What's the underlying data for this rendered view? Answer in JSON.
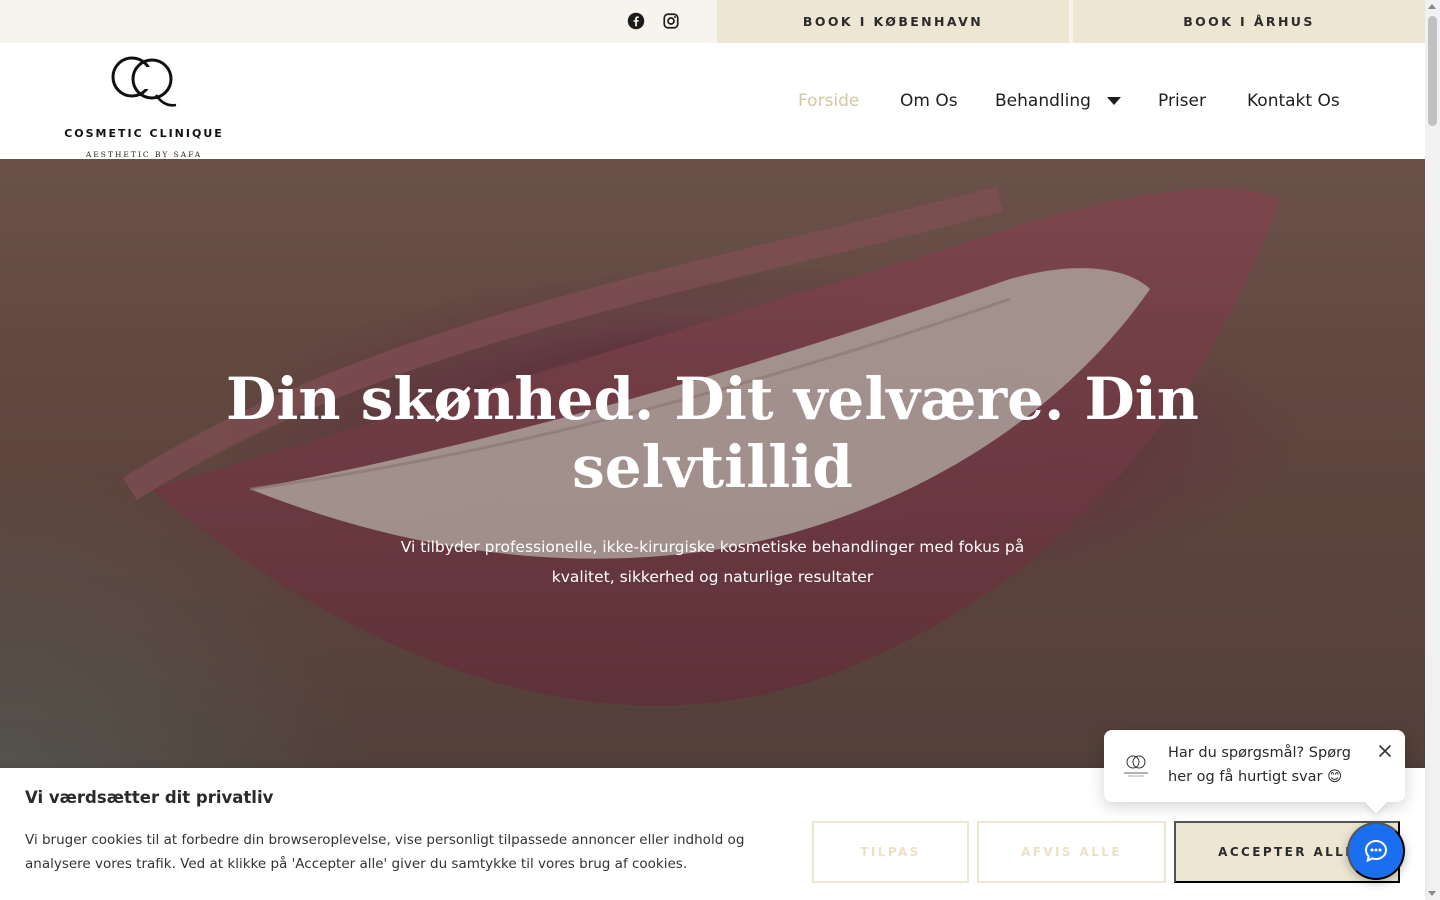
{
  "topbar": {
    "social": [
      {
        "icon": "facebook-icon"
      },
      {
        "icon": "instagram-icon"
      }
    ],
    "book_copenhagen": "BOOK I KØBENHAVN",
    "book_aarhus": "BOOK I ÅRHUS"
  },
  "logo": {
    "mark": "CQ",
    "name": "COSMETIC CLINIQUE",
    "tagline": "AESTHETIC BY SAFA"
  },
  "nav": {
    "items": [
      {
        "label": "Forside",
        "active": true
      },
      {
        "label": "Om Os"
      },
      {
        "label": "Behandling",
        "has_dropdown": true
      },
      {
        "label": "Priser"
      },
      {
        "label": "Kontakt Os"
      }
    ]
  },
  "hero": {
    "title": "Din skønhed. Dit velvære. Din selvtillid",
    "subtitle": "Vi tilbyder professionelle, ikke-kirurgiske kosmetiske behandlinger med fokus på kvalitet, sikkerhed og naturlige resultater"
  },
  "cookie": {
    "title": "Vi værdsætter dit privatliv",
    "text": "Vi bruger cookies til at forbedre din browseroplevelse, vise personligt tilpassede annoncer eller indhold og analysere vores trafik. Ved at klikke på 'Accepter alle' giver du samtykke til vores brug af cookies.",
    "customize": "TILPAS",
    "reject": "AFVIS ALLE",
    "accept": "ACCEPTER ALLE"
  },
  "chat": {
    "message": "Har du spørgsmål? Spørg her og få hurtigt svar 😊"
  },
  "colors": {
    "accent": "#d3c7a4",
    "button_bg": "#ece6d2",
    "chat_blue": "#1a6ff0"
  }
}
